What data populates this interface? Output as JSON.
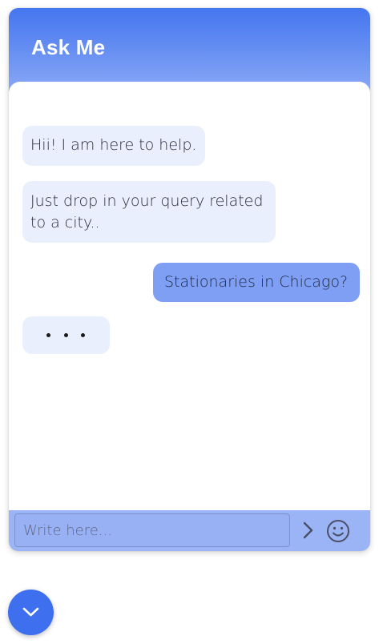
{
  "header": {
    "title": "Ask Me"
  },
  "messages": [
    {
      "sender": "bot",
      "text": "Hii! I am here to help."
    },
    {
      "sender": "bot",
      "text": "Just drop in your query related to a city.."
    },
    {
      "sender": "user",
      "text": "Stationaries in Chicago?"
    },
    {
      "sender": "bot",
      "typing": true
    }
  ],
  "composer": {
    "placeholder": "Write here...",
    "value": "",
    "send_icon": "chevron-right-icon",
    "emoji_icon": "smiley-icon"
  },
  "toggle": {
    "icon": "chevron-down-icon"
  },
  "colors": {
    "header_top": "#4476ef",
    "header_bottom": "#93aff7",
    "bot_bubble": "#e9effc",
    "user_bubble": "#7f9ff5",
    "footer": "#9bb4f6",
    "fab": "#3d6fef"
  }
}
